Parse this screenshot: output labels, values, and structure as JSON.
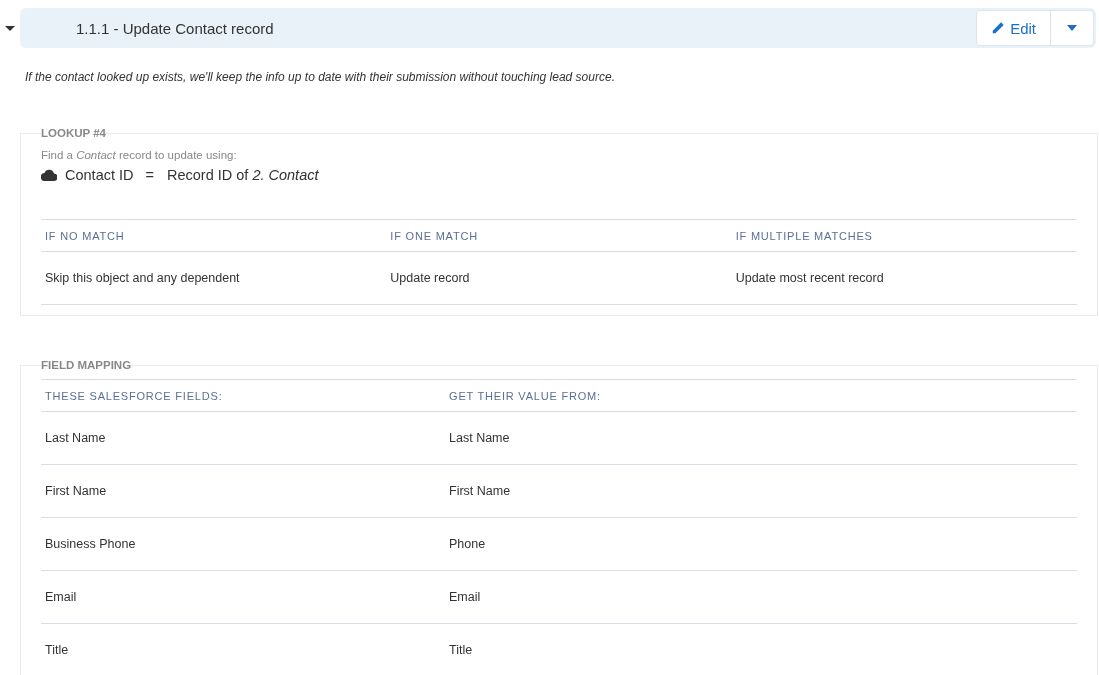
{
  "step": {
    "title": "1.1.1 - Update Contact record",
    "expanded": true,
    "edit_label": "Edit"
  },
  "description": "If the contact looked up exists, we'll keep the info up to date with their submission without touching lead source.",
  "lookup": {
    "legend": "LOOKUP #4",
    "intro": "Find a *Contact* record to update using:",
    "field": "Contact ID",
    "operator": "=",
    "value": "Record ID of *2. Contact*",
    "columns": [
      "IF NO MATCH",
      "IF ONE MATCH",
      "IF MULTIPLE MATCHES"
    ],
    "row": [
      "Skip this object and any dependent",
      "Update record",
      "Update most recent record"
    ]
  },
  "field_mapping": {
    "legend": "FIELD MAPPING",
    "columns": [
      "THESE SALESFORCE FIELDS:",
      "GET THEIR VALUE FROM:"
    ],
    "rows": [
      [
        "Last Name",
        "Last Name"
      ],
      [
        "First Name",
        "First Name"
      ],
      [
        "Business Phone",
        "Phone"
      ],
      [
        "Email",
        "Email"
      ],
      [
        "Title",
        "Title"
      ]
    ]
  }
}
